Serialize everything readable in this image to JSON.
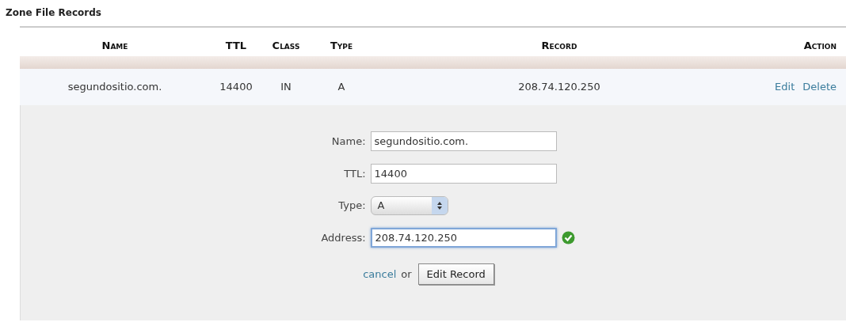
{
  "title": "Zone File Records",
  "table": {
    "columns": [
      "Name",
      "TTL",
      "Class",
      "Type",
      "Record",
      "Action"
    ],
    "rows": [
      {
        "name": "segundositio.com.",
        "ttl": "14400",
        "class": "IN",
        "type": "A",
        "record": "208.74.120.250",
        "actions": [
          "Edit",
          "Delete"
        ]
      }
    ]
  },
  "edit_form": {
    "fields": [
      {
        "kind": "text",
        "label": "Name:",
        "value": "segundositio.com.",
        "focused": false
      },
      {
        "kind": "text",
        "label": "TTL:",
        "value": "14400",
        "focused": false
      },
      {
        "kind": "select",
        "label": "Type:",
        "value": "A",
        "focused": false
      },
      {
        "kind": "text",
        "label": "Address:",
        "value": "208.74.120.250",
        "focused": true,
        "valid": true
      }
    ],
    "cancel": "cancel",
    "or": "or",
    "submit": "Edit Record"
  }
}
